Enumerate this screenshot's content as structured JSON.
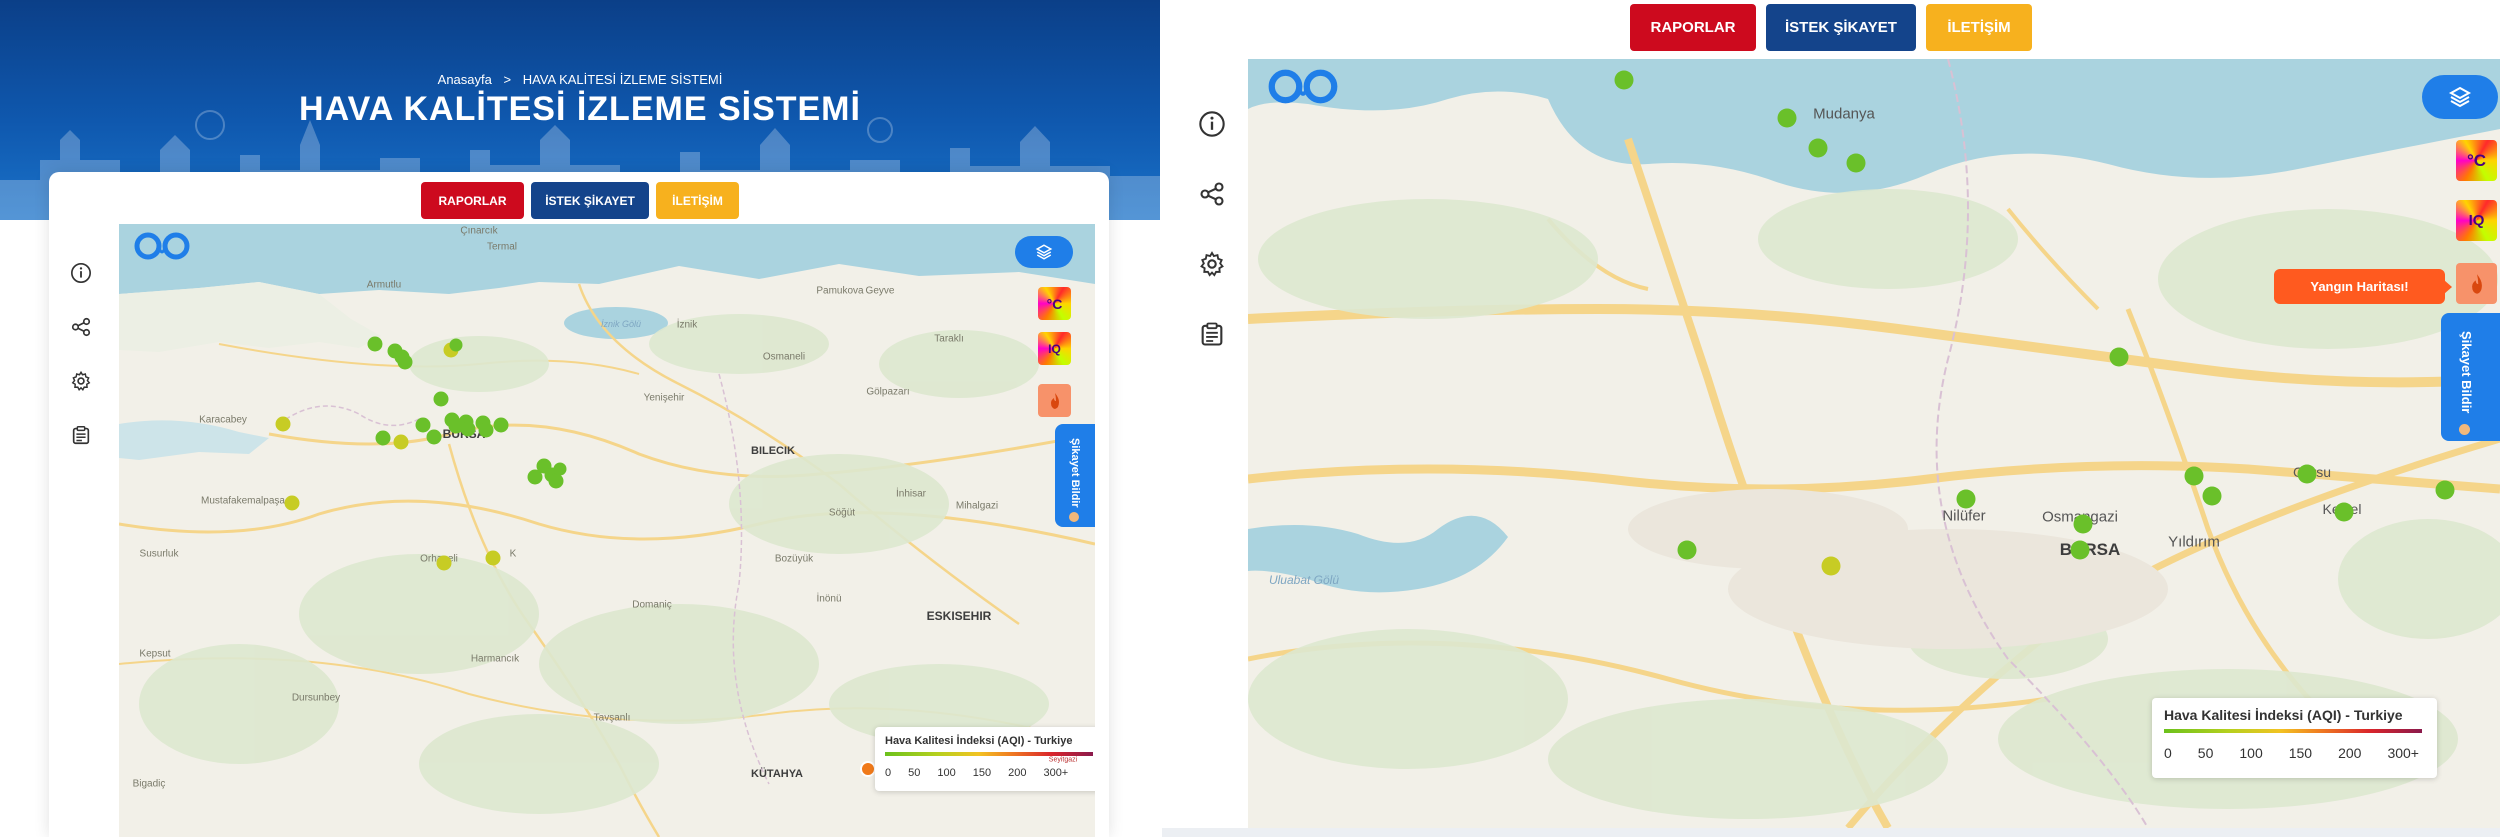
{
  "left": {
    "breadcrumb": {
      "home": "Anasayfa",
      "separator": ">",
      "current": "HAVA KALİTESİ İZLEME SİSTEMİ"
    },
    "title": "HAVA KALİTESİ İZLEME SİSTEMİ",
    "buttons": {
      "reports": "RAPORLAR",
      "request": "İSTEK ŞİKAYET",
      "contact": "İLETİŞİM"
    },
    "map_labels": {
      "cinarcik": "Çınarcık",
      "termal": "Termal",
      "armutlu": "Armutlu",
      "iznik_golu": "İznik Gölü",
      "iznik": "İznik",
      "pamukova": "Pamukova",
      "geyve": "Geyve",
      "tarakli": "Taraklı",
      "osmaneli": "Osmaneli",
      "golpazari": "Gölpazarı",
      "yenisehir": "Yenişehir",
      "karacabey": "Karacabey",
      "bursa": "BURSA",
      "bilecik": "BILECIK",
      "mustafakemalpasa": "Mustafakemalpaşa",
      "inhisar": "İnhisar",
      "mihalgazi": "Mihalgazi",
      "sogut": "Söğüt",
      "susurluk": "Susurluk",
      "orhaneli": "Orhaneli",
      "keles": "K",
      "bozuyuk": "Bozüyük",
      "inonu": "İnönü",
      "domanic": "Domaniç",
      "eskisehir": "ESKISEHIR",
      "kepsut": "Kepsut",
      "harmancik": "Harmancık",
      "dursunbey": "Dursunbey",
      "tavsanli": "Tavşanlı",
      "bigadic": "Bigadiç",
      "kutahya": "KÜTAHYA"
    },
    "sikayet": "Şikayet Bildir",
    "legend": {
      "title": "Hava Kalitesi İndeksi (AQI) - Turkiye",
      "sub": "Seyitgazi",
      "ticks": [
        "0",
        "50",
        "100",
        "150",
        "200",
        "300+"
      ]
    }
  },
  "right": {
    "buttons": {
      "reports": "RAPORLAR",
      "request": "İSTEK ŞİKAYET",
      "contact": "İLETİŞİM"
    },
    "map_labels": {
      "mudanya": "Mudanya",
      "nilufer": "Nilüfer",
      "osmangazi": "Osmangazi",
      "bursa": "BURSA",
      "yildirim": "Yıldırım",
      "gursu": "Gürsu",
      "kestel": "Kestel",
      "uluabat_golu": "Uluabat Gölü"
    },
    "tooltip": "Yangın Haritası!",
    "sikayet": "Şikayet Bildir",
    "legend": {
      "title": "Hava Kalitesi İndeksi (AQI) - Turkiye",
      "ticks": [
        "0",
        "50",
        "100",
        "150",
        "200",
        "300+"
      ]
    }
  },
  "icons": {
    "side": [
      "info-icon",
      "share-icon",
      "settings-icon",
      "clipboard-icon"
    ],
    "logo": "logo-icon",
    "layers": "layers-icon",
    "temperature_tile": "temperature-heatmap-icon",
    "aqi_tile": "aqi-heatmap-icon",
    "fire_tile": "fire-icon"
  },
  "colors": {
    "header_blue": "#0f58ae",
    "btn_red": "#cd0a1e",
    "btn_blue": "#14448b",
    "btn_yellow": "#f7b11e",
    "accent_blue": "#1f7ee8",
    "aqi_good": "#6ac02a",
    "aqi_moderate": "#c7cc24",
    "tooltip_orange": "#ff5a1f"
  },
  "stations": {
    "left": [
      "good",
      "good",
      "good",
      "good",
      "moderate",
      "good",
      "good",
      "moderate",
      "good",
      "good",
      "good",
      "good",
      "good",
      "moderate",
      "good",
      "good",
      "good",
      "good",
      "good",
      "good",
      "moderate",
      "moderate"
    ],
    "right": [
      "good",
      "good",
      "good",
      "good",
      "good",
      "good",
      "good",
      "good",
      "good",
      "good",
      "good",
      "good",
      "good",
      "good",
      "good",
      "moderate",
      "good"
    ]
  }
}
